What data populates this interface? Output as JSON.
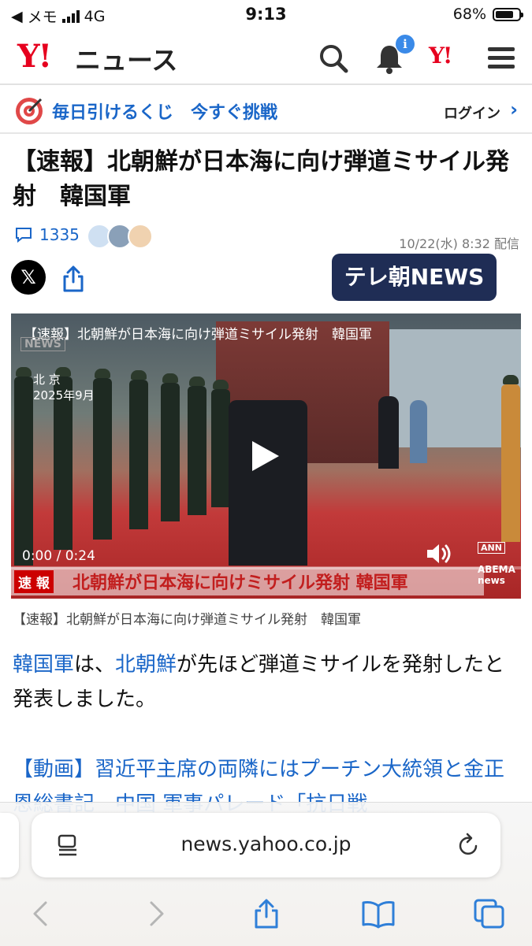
{
  "status_bar": {
    "back_label": "メモ",
    "network": "4G",
    "time": "9:13",
    "battery": "68%",
    "battery_level": 0.68
  },
  "header": {
    "logo": "Y!",
    "service": "ニュース",
    "notification_badge": "i",
    "yahoo_top": "Y!"
  },
  "promo": {
    "text": "毎日引けるくじ　今すぐ挑戦",
    "login": "ログイン",
    "chevron": "›"
  },
  "article": {
    "title": "【速報】北朝鮮が日本海に向け弾道ミサイル発射　韓国軍",
    "comment_count": "1335",
    "date": "10/22(水) 8:32 配信",
    "x_share": "𝕏",
    "source_logo": "テレ朝NEWS"
  },
  "video": {
    "title": "【速報】北朝鮮が日本海に向け弾道ミサイル発射　韓国軍",
    "news_label": "NEWS",
    "location": "北 京\n2025年9月",
    "time": "0:00 / 0:24",
    "ann": "ANN",
    "ticker_label": "速 報",
    "ticker_text": "北朝鮮が日本海に向けミサイル発射 韓国軍",
    "abema": "ABEMA\nnews",
    "caption": "【速報】北朝鮮が日本海に向け弾道ミサイル発射　韓国軍"
  },
  "body": {
    "link1": "韓国軍",
    "text1": "は、",
    "link2": "北朝鮮",
    "text2": "が先ほど弾道ミサイルを発射したと発表しました。",
    "related": "【動画】習近平主席の両隣にはプーチン大統領と金正恩総書記　中国 軍事パレード「抗日戦"
  },
  "browser": {
    "url": "news.yahoo.co.jp"
  },
  "colors": {
    "brand_red": "#e6001e",
    "link_blue": "#1a66c8",
    "telasa_navy": "#1f2d55"
  }
}
